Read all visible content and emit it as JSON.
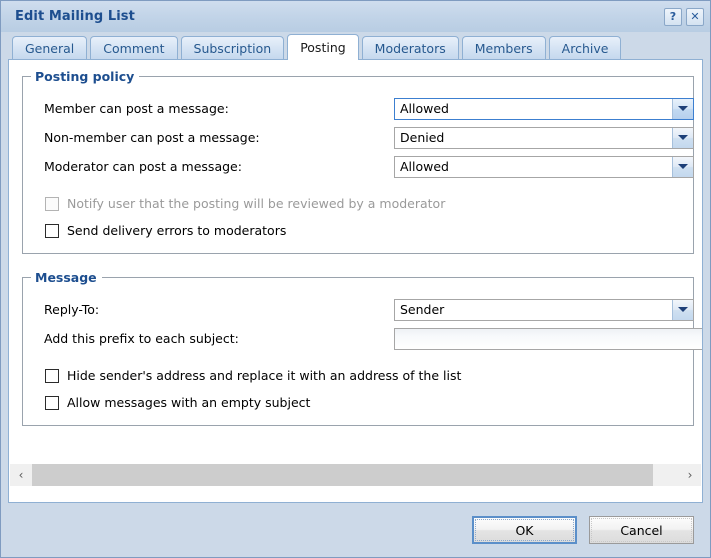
{
  "window": {
    "title": "Edit Mailing List",
    "help_button": "?",
    "close_button": "✕"
  },
  "tabs": [
    {
      "label": "General",
      "active": false
    },
    {
      "label": "Comment",
      "active": false
    },
    {
      "label": "Subscription",
      "active": false
    },
    {
      "label": "Posting",
      "active": true
    },
    {
      "label": "Moderators",
      "active": false
    },
    {
      "label": "Members",
      "active": false
    },
    {
      "label": "Archive",
      "active": false
    }
  ],
  "posting_policy": {
    "legend": "Posting policy",
    "fields": [
      {
        "label": "Member can post a message:",
        "value": "Allowed"
      },
      {
        "label": "Non-member can post a message:",
        "value": "Denied"
      },
      {
        "label": "Moderator can post a message:",
        "value": "Allowed"
      }
    ],
    "checkboxes": [
      {
        "label": "Notify user that the posting will be reviewed by a moderator",
        "checked": false,
        "disabled": true
      },
      {
        "label": "Send delivery errors to moderators",
        "checked": false,
        "disabled": false
      }
    ]
  },
  "message": {
    "legend": "Message",
    "reply_to_label": "Reply-To:",
    "reply_to_value": "Sender",
    "prefix_label": "Add this prefix to each subject:",
    "prefix_value": "",
    "prefix_placeholder": "",
    "checkboxes": [
      {
        "label": "Hide sender's address and replace it with an address of the list",
        "checked": false
      },
      {
        "label": "Allow messages with an empty subject",
        "checked": false
      }
    ]
  },
  "scrollbar": {
    "left_arrow": "‹",
    "right_arrow": "›"
  },
  "footer": {
    "ok_label": "OK",
    "cancel_label": "Cancel"
  },
  "colors": {
    "title_text": "#1d4e8f",
    "legend_text": "#1d4e8f",
    "window_chrome": "#ccd9e8",
    "tab_active_bg": "#ffffff",
    "focus_border": "#3c7fd0"
  }
}
